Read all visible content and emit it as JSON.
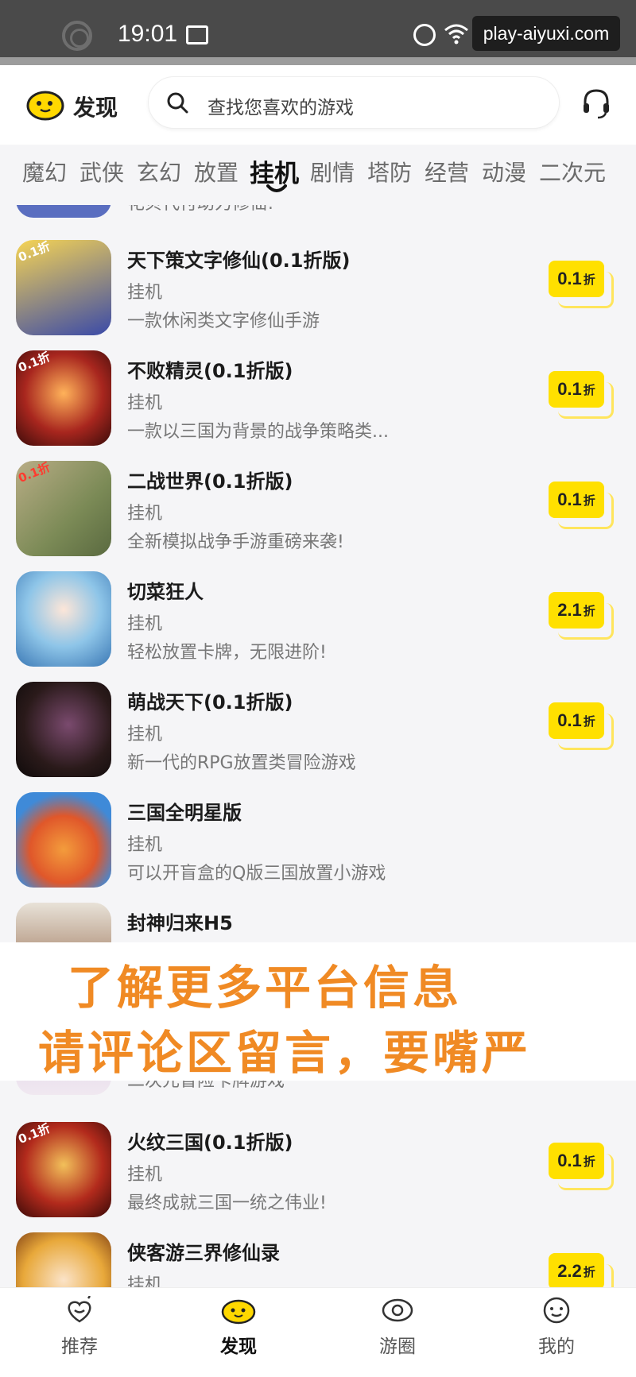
{
  "status_bar": {
    "time": "19:01",
    "watermark": "play-aiyuxi.com"
  },
  "header": {
    "title": "发现",
    "search_placeholder": "查找您喜欢的游戏"
  },
  "tabs": [
    "魔幻",
    "武侠",
    "玄幻",
    "放置",
    "挂机",
    "剧情",
    "塔防",
    "经营",
    "动漫",
    "二次元"
  ],
  "active_tab": "挂机",
  "partial_top_desc": "花贝代付助力修仙!",
  "games": [
    {
      "name": "天下策文字修仙(0.1折版)",
      "category": "挂机",
      "desc": "一款休闲类文字修仙手游",
      "discount": "0.1",
      "unit": "折",
      "icon_color": "#3a4aa8"
    },
    {
      "name": "不败精灵(0.1折版)",
      "category": "挂机",
      "desc": "一款以三国为背景的战争策略类...",
      "discount": "0.1",
      "unit": "折",
      "icon_color": "#a8261e"
    },
    {
      "name": "二战世界(0.1折版)",
      "category": "挂机",
      "desc": "全新模拟战争手游重磅来袭!",
      "discount": "0.1",
      "unit": "折",
      "icon_color": "#8a8a58"
    },
    {
      "name": "切菜狂人",
      "category": "挂机",
      "desc": "轻松放置卡牌，无限进阶!",
      "discount": "2.1",
      "unit": "折",
      "icon_color": "#8ec5e8"
    },
    {
      "name": "萌战天下(0.1折版)",
      "category": "挂机",
      "desc": "新一代的RPG放置类冒险游戏",
      "discount": "0.1",
      "unit": "折",
      "icon_color": "#2a1a1a"
    },
    {
      "name": "三国全明星版",
      "category": "挂机",
      "desc": "可以开盲盒的Q版三国放置小游戏",
      "discount": "",
      "unit": "",
      "icon_color": "#3f8ad8"
    },
    {
      "name": "封神归来H5",
      "category": "",
      "desc": "",
      "discount": "",
      "unit": "",
      "icon_color": "#cfc7bb"
    }
  ],
  "partial_mid_desc": "二次元冒险卡牌游戏",
  "games_after": [
    {
      "name": "火纹三国(0.1折版)",
      "category": "挂机",
      "desc": "最终成就三国一统之伟业!",
      "discount": "0.1",
      "unit": "折",
      "icon_color": "#b22a1c"
    },
    {
      "name": "侠客游三界修仙录",
      "category": "挂机",
      "desc": "",
      "discount": "2.2",
      "unit": "折",
      "icon_color": "#e8a83a"
    }
  ],
  "thumb_tag": "0.1折",
  "overlay": {
    "line1": "了解更多平台信息",
    "line2": "请评论区留言，要嘴严"
  },
  "bottom_nav": [
    "推荐",
    "发现",
    "游圈",
    "我的"
  ],
  "bottom_nav_active": "发现",
  "colors": {
    "accent": "#ffe000",
    "overlay_text": "#f08a24"
  }
}
